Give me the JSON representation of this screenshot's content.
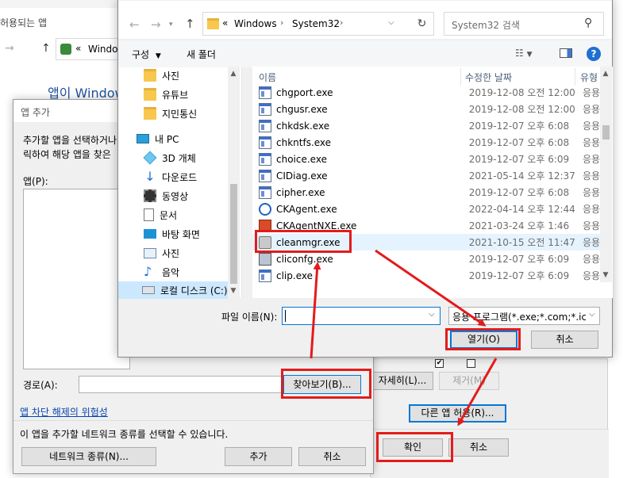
{
  "background": {
    "window_title": "허용되는 앱",
    "address_text": "Window",
    "heading_text": "앱이 Window"
  },
  "file_dialog": {
    "address": {
      "chevrons": "«",
      "crumbs": [
        "Windows",
        "System32"
      ],
      "search_placeholder": "System32 검색"
    },
    "toolbar": {
      "organize": "구성",
      "new_folder": "새 폴더"
    },
    "nav_items": [
      {
        "label": "사진",
        "icon": "folder-icon"
      },
      {
        "label": "유튜브",
        "icon": "folder-icon"
      },
      {
        "label": "지민통신",
        "icon": "folder-icon"
      },
      {
        "label": "내 PC",
        "icon": "pc-icon"
      },
      {
        "label": "3D 개체",
        "icon": "cube-icon"
      },
      {
        "label": "다운로드",
        "icon": "download-icon"
      },
      {
        "label": "동영상",
        "icon": "video-icon"
      },
      {
        "label": "문서",
        "icon": "document-icon"
      },
      {
        "label": "바탕 화면",
        "icon": "desktop-icon"
      },
      {
        "label": "사진",
        "icon": "picture-icon"
      },
      {
        "label": "음악",
        "icon": "music-icon"
      },
      {
        "label": "로컬 디스크 (C:)",
        "icon": "drive-icon"
      }
    ],
    "columns": {
      "name": "이름",
      "date": "수정한 날짜",
      "type": "유형"
    },
    "files": [
      {
        "name": "chgport.exe",
        "date": "2019-12-08 오전 12:00",
        "type": "응용"
      },
      {
        "name": "chgusr.exe",
        "date": "2019-12-08 오전 12:00",
        "type": "응용"
      },
      {
        "name": "chkdsk.exe",
        "date": "2019-12-07 오후 6:08",
        "type": "응용"
      },
      {
        "name": "chkntfs.exe",
        "date": "2019-12-07 오후 6:08",
        "type": "응용"
      },
      {
        "name": "choice.exe",
        "date": "2019-12-07 오후 6:09",
        "type": "응용"
      },
      {
        "name": "CIDiag.exe",
        "date": "2021-05-14 오후 12:37",
        "type": "응용"
      },
      {
        "name": "cipher.exe",
        "date": "2019-12-07 오후 6:08",
        "type": "응용"
      },
      {
        "name": "CKAgent.exe",
        "date": "2022-04-14 오후 12:44",
        "type": "응용"
      },
      {
        "name": "CKAgentNXE.exe",
        "date": "2021-03-24 오후 1:46",
        "type": "응용"
      },
      {
        "name": "cleanmgr.exe",
        "date": "2021-10-15 오전 11:47",
        "type": "응용"
      },
      {
        "name": "cliconfg.exe",
        "date": "2019-12-07 오후 6:09",
        "type": "응용"
      },
      {
        "name": "clip.exe",
        "date": "2019-12-07 오후 6:09",
        "type": "응용"
      }
    ],
    "filename_label": "파일 이름(N):",
    "filename_value": "",
    "filetype_value": "응용 프로그램(*.exe;*.com;*.icd",
    "open_button": "열기(O)",
    "cancel_button": "취소"
  },
  "add_app_dialog": {
    "title": "앱 추가",
    "instruction_line1": "추가할 앱을 선택하거나",
    "instruction_line2": "릭하여 해당 앱을 찾은",
    "apps_label": "앱(P):",
    "path_label": "경로(A):",
    "browse_button": "찾아보기(B)...",
    "risk_link": "앱 차단 해제의 위험성",
    "network_text": "이 앱을 추가할 네트워크 종류를 선택할 수 있습니다.",
    "network_type_button": "네트워크 종류(N)...",
    "add_button": "추가",
    "cancel_button": "취소"
  },
  "behind_dialog": {
    "details_button": "자세히(L)...",
    "remove_button": "제거(M)",
    "allow_other_button": "다른 앱 허용(R)...",
    "ok_button": "확인",
    "cancel_button": "취소"
  }
}
